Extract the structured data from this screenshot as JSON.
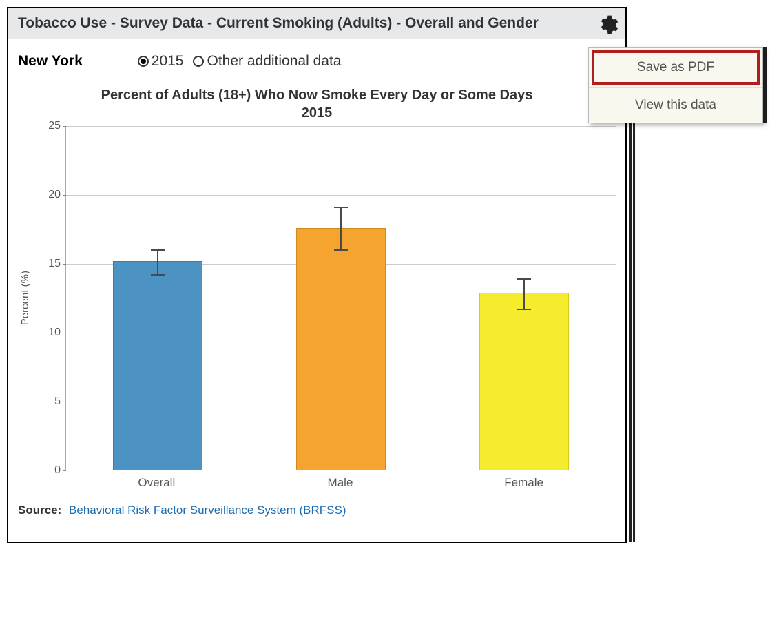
{
  "header": {
    "title": "Tobacco Use - Survey Data - Current Smoking (Adults) - Overall and Gender"
  },
  "controls": {
    "location": "New York",
    "radio_2015": "2015",
    "radio_other": "Other additional data",
    "selected": "2015"
  },
  "menu": {
    "save_pdf": "Save as PDF",
    "view_data": "View this data"
  },
  "chart": {
    "title_line1": "Percent of Adults (18+) Who Now Smoke Every Day or Some Days",
    "title_line2": "2015",
    "ylabel": "Percent (%)",
    "yticks": [
      "0",
      "5",
      "10",
      "15",
      "20",
      "25"
    ],
    "xlabels": [
      "Overall",
      "Male",
      "Female"
    ]
  },
  "source": {
    "label": "Source:",
    "link_text": "Behavioral Risk Factor Surveillance System (BRFSS)"
  },
  "chart_data": {
    "type": "bar",
    "title": "Percent of Adults (18+) Who Now Smoke Every Day or Some Days 2015",
    "xlabel": "",
    "ylabel": "Percent (%)",
    "ylim": [
      0,
      25
    ],
    "categories": [
      "Overall",
      "Male",
      "Female"
    ],
    "series": [
      {
        "name": "Percent",
        "values": [
          15.2,
          17.6,
          12.9
        ],
        "error_low": [
          14.3,
          16.1,
          11.8
        ],
        "error_high": [
          16.1,
          19.2,
          14.0
        ],
        "colors": [
          "#4c93c3",
          "#f6a430",
          "#f5ec2d"
        ]
      }
    ]
  }
}
